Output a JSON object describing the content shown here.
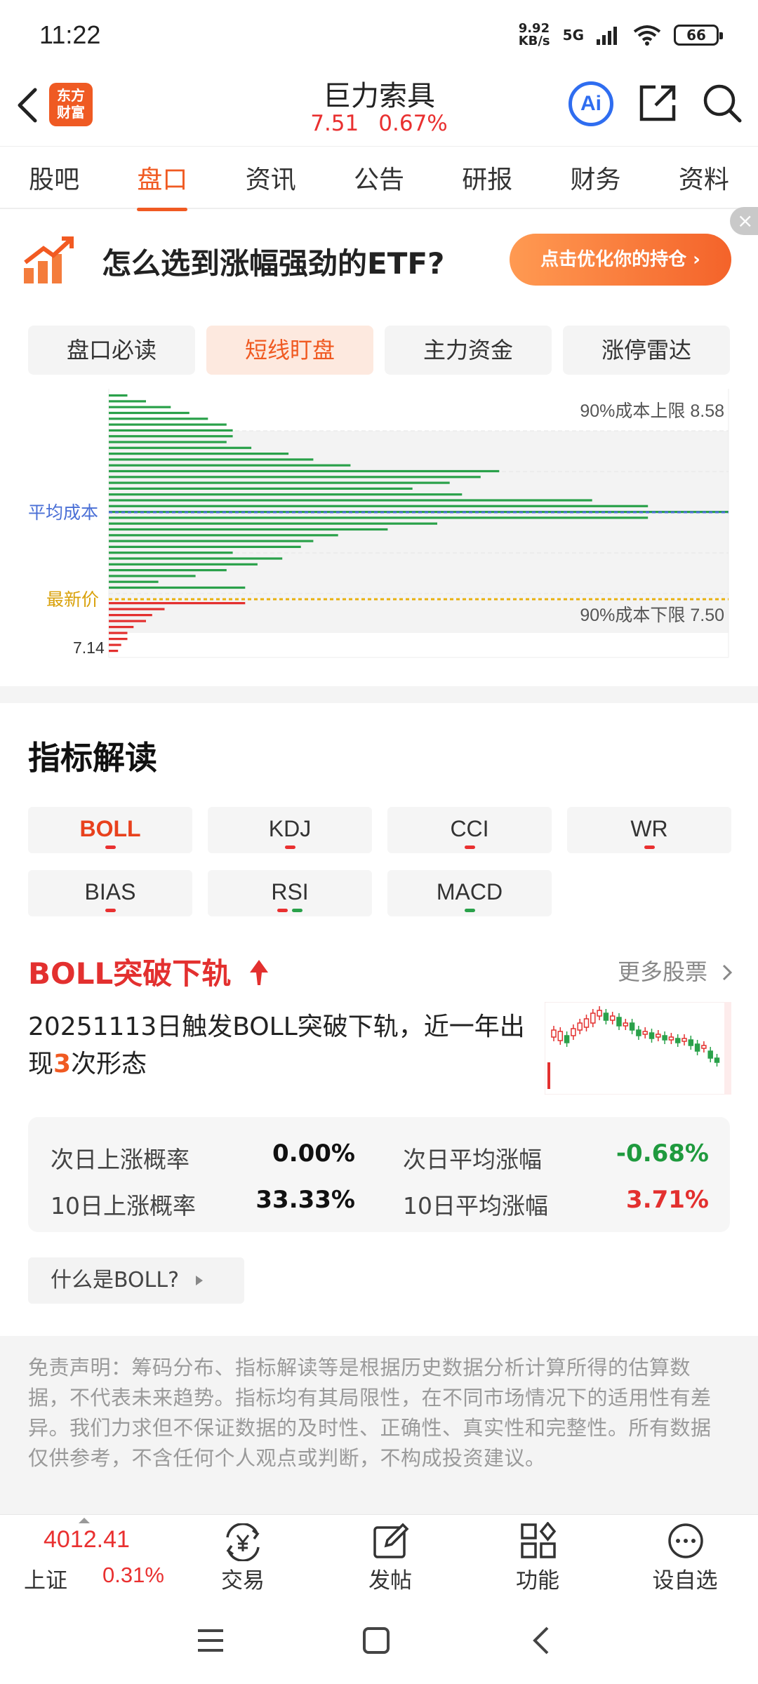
{
  "status": {
    "time": "11:22",
    "speed": "9.92\nKB/s",
    "network": "5G",
    "battery": "66"
  },
  "header": {
    "stock_name": "巨力索具",
    "price": "7.51",
    "change_pct": "0.67%",
    "logo_text": "东方财富"
  },
  "tabs": [
    {
      "label": "股吧"
    },
    {
      "label": "盘口"
    },
    {
      "label": "资讯"
    },
    {
      "label": "公告"
    },
    {
      "label": "研报"
    },
    {
      "label": "财务"
    },
    {
      "label": "资料"
    }
  ],
  "banner": {
    "text": "怎么选到涨幅强劲的ETF?",
    "button": "点击优化你的持仓 ›",
    "close": "×"
  },
  "subtabs": [
    {
      "label": "盘口必读"
    },
    {
      "label": "短线盯盘"
    },
    {
      "label": "主力资金"
    },
    {
      "label": "涨停雷达"
    }
  ],
  "chip_chart": {
    "upper_label": "90%成本上限 8.58",
    "lower_label": "90%成本下限 7.50",
    "avg_cost_label": "平均成本",
    "latest_price_label": "最新价",
    "min_price_label": "7.14",
    "colors": {
      "green": "#2aa14a",
      "red": "#e3302f",
      "avg_line": "#4a6fd6",
      "price_line": "#e9b10f"
    },
    "green_bars": [
      0.03,
      0.06,
      0.1,
      0.13,
      0.16,
      0.19,
      0.2,
      0.2,
      0.19,
      0.23,
      0.29,
      0.33,
      0.39,
      0.63,
      0.6,
      0.55,
      0.49,
      0.57,
      0.78,
      0.87,
      1.0,
      0.87,
      0.53,
      0.45,
      0.37,
      0.33,
      0.31,
      0.2,
      0.28,
      0.24,
      0.19,
      0.14,
      0.08,
      0.22
    ],
    "red_bars": [
      0.22,
      0.09,
      0.07,
      0.06,
      0.04,
      0.03,
      0.03,
      0.02,
      0.015
    ]
  },
  "indicators": {
    "title": "指标解读",
    "items": [
      {
        "label": "BOLL",
        "marks": [
          "r"
        ]
      },
      {
        "label": "KDJ",
        "marks": [
          "r"
        ]
      },
      {
        "label": "CCI",
        "marks": [
          "r"
        ]
      },
      {
        "label": "WR",
        "marks": [
          "r"
        ]
      },
      {
        "label": "BIAS",
        "marks": [
          "r"
        ]
      },
      {
        "label": "RSI",
        "marks": [
          "r",
          "g"
        ]
      },
      {
        "label": "MACD",
        "marks": [
          "g"
        ]
      }
    ]
  },
  "signal": {
    "title": "BOLL突破下轨",
    "more": "更多股票",
    "desc_pre": "20251113日触发BOLL突破下轨，近一年出现",
    "desc_count": "3",
    "desc_post": "次形态"
  },
  "stats": {
    "next_up_prob_label": "次日上涨概率",
    "next_up_prob": "0.00%",
    "next_avg_label": "次日平均涨幅",
    "next_avg": "-0.68%",
    "ten_up_prob_label": "10日上涨概率",
    "ten_up_prob": "33.33%",
    "ten_avg_label": "10日平均涨幅",
    "ten_avg": "3.71%"
  },
  "whatis": "什么是BOLL?",
  "disclaimer": "免责声明：筹码分布、指标解读等是根据历史数据分析计算所得的估算数据，不代表未来趋势。指标均有其局限性，在不同市场情况下的适用性有差异。我们力求但不保证数据的及时性、正确性、真实性和完整性。所有数据仅供参考，不含任何个人观点或判断，不构成投资建议。",
  "bottom_bar": {
    "index_value": "4012.41",
    "index_name": "上证",
    "index_pct": "0.31%",
    "trade": "交易",
    "post": "发帖",
    "function": "功能",
    "watchlist": "设自选"
  }
}
